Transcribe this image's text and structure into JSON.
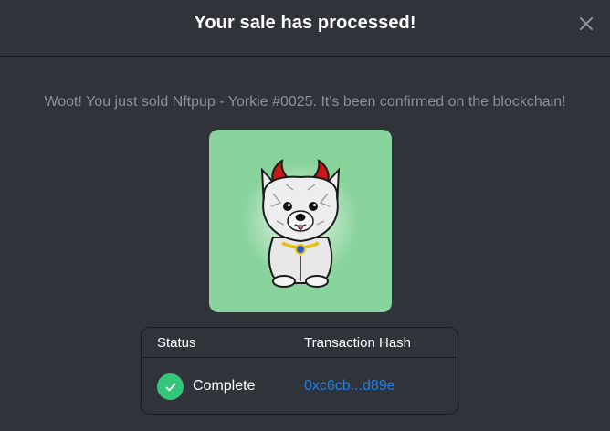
{
  "modal": {
    "title": "Your sale has processed!",
    "close_icon": "close-icon",
    "message": "Woot! You just sold Nftpup - Yorkie #0025. It's been confirmed on the blockchain!"
  },
  "nft": {
    "image_icon": "yorkie-puppy-with-devil-horns",
    "background_color": "#89d39c"
  },
  "transaction_table": {
    "headers": {
      "status": "Status",
      "hash": "Transaction Hash"
    },
    "row": {
      "status_icon": "check-icon",
      "status": "Complete",
      "hash": "0xc6cb...d89e"
    }
  },
  "colors": {
    "background": "#303339",
    "link": "#2081e2",
    "success": "#34c77b",
    "muted_text": "#8a939b"
  }
}
